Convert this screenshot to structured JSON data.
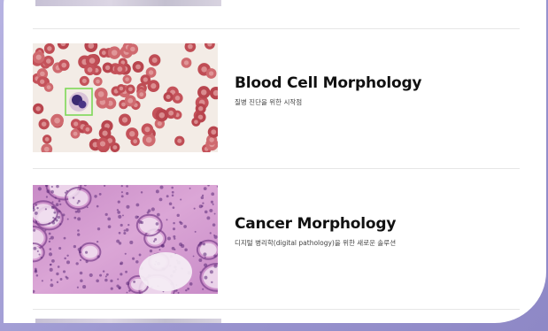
{
  "cards": [
    {
      "title": "Blood Cell Morphology",
      "subtitle": "질병 진단을 위한 시작점",
      "image": "blood-smear-image"
    },
    {
      "title": "Cancer Morphology",
      "subtitle": "디지털 병리학(digital pathology)을 위한 새로운 솔루션",
      "image": "cancer-histology-image"
    }
  ],
  "colors": {
    "frame": "#9c97cf",
    "card": "#ffffff",
    "title": "#111111",
    "detection_box": "#7ed957"
  }
}
